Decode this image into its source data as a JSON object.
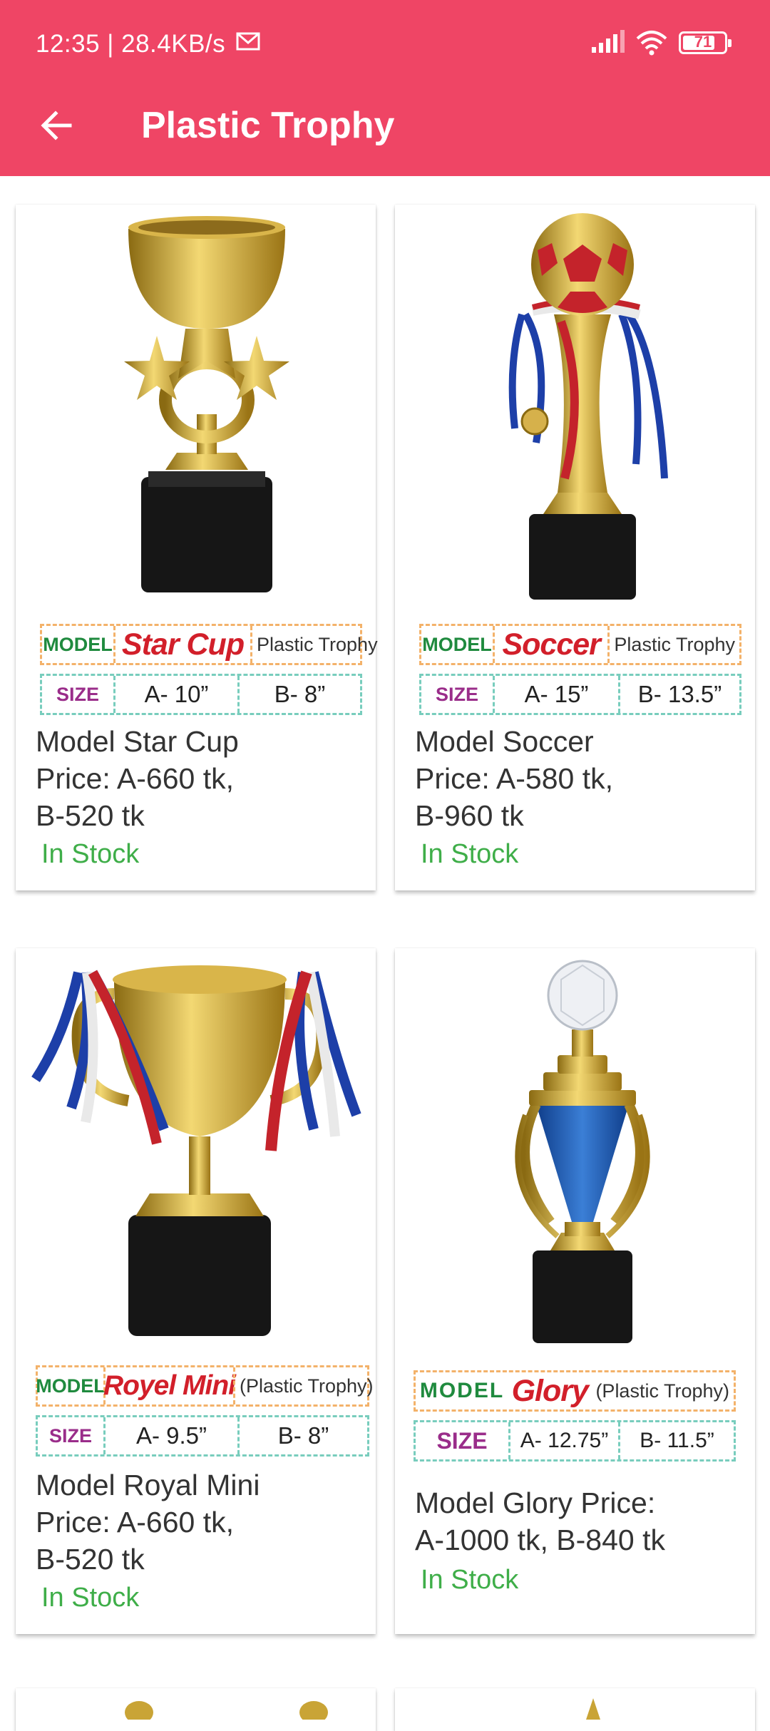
{
  "status_bar": {
    "time": "12:35 | 28.4KB/s",
    "battery": "71"
  },
  "app_bar": {
    "title": "Plastic Trophy"
  },
  "products": [
    {
      "badge_model": "MODEL",
      "badge_name": "Star Cup",
      "badge_type": "Plastic Trophy",
      "badge_size": "SIZE",
      "size_a": "A- 10”",
      "size_b": "B- 8”",
      "line1": "Model Star Cup",
      "line2": "Price: A-660 tk,",
      "line3": "B-520 tk",
      "stock": "In Stock"
    },
    {
      "badge_model": "MODEL",
      "badge_name": "Soccer",
      "badge_type": "Plastic Trophy",
      "badge_size": "SIZE",
      "size_a": "A- 15”",
      "size_b": "B- 13.5”",
      "line1": "Model Soccer",
      "line2": "Price: A-580 tk,",
      "line3": "B-960 tk",
      "stock": "In Stock"
    },
    {
      "badge_model": "MODEL",
      "badge_name": "Royel Mini",
      "badge_type": "(Plastic Trophy)",
      "badge_size": "SIZE",
      "size_a": "A- 9.5”",
      "size_b": "B- 8”",
      "line1": "Model Royal Mini",
      "line2": "Price: A-660 tk,",
      "line3": "B-520 tk",
      "stock": "In Stock"
    },
    {
      "badge_model": "MODEL",
      "badge_name": "Glory",
      "badge_type": "(Plastic Trophy)",
      "badge_size": "SIZE",
      "size_a": "A- 12.75”",
      "size_b": "B- 11.5”",
      "line1": "Model Glory Price:",
      "line2": "A-1000 tk, B-840 tk",
      "stock": "In Stock"
    }
  ]
}
